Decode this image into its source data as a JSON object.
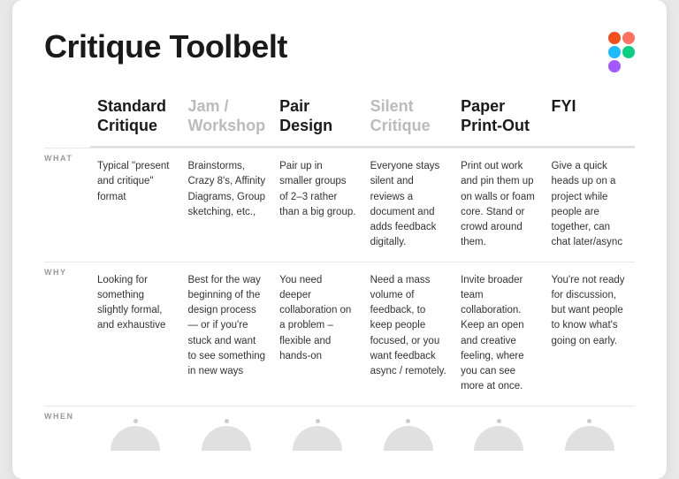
{
  "title": "Critique Toolbelt",
  "figma": {
    "dots": [
      {
        "color": "#F24E1E"
      },
      {
        "color": "#FF7262"
      },
      {
        "color": "#1ABCFE"
      },
      {
        "color": "#0ACF83"
      },
      {
        "color": "#A259FF"
      },
      {
        "color": "#0ACF83"
      }
    ]
  },
  "columns": [
    {
      "header_line1": "Standard",
      "header_line2": "Critique",
      "muted": false,
      "what": "Typical \"present and critique\" format",
      "why": "Looking for something slightly formal, and exhaustive"
    },
    {
      "header_line1": "Jam /",
      "header_line2": "Workshop",
      "muted": true,
      "what": "Brainstorms, Crazy 8's, Affinity Diagrams, Group sketching, etc.,",
      "why": "Best for the way beginning of the design process— or if you're stuck and want to see something in new ways"
    },
    {
      "header_line1": "Pair",
      "header_line2": "Design",
      "muted": false,
      "what": "Pair up in smaller groups of 2–3 rather than a big group.",
      "why": "You need deeper collaboration on a problem – flexible and hands-on"
    },
    {
      "header_line1": "Silent",
      "header_line2": "Critique",
      "muted": true,
      "what": "Everyone stays silent and reviews a document and adds feedback digitally.",
      "why": "Need a mass volume of feedback, to keep people focused, or you want feedback async / remotely."
    },
    {
      "header_line1": "Paper",
      "header_line2": "Print-Out",
      "muted": false,
      "what": "Print out work and pin them up on walls or foam core. Stand or crowd around them.",
      "why": "Invite broader team collaboration. Keep an open and creative feeling, where you can see more at once."
    },
    {
      "header_line1": "FYI",
      "header_line2": "",
      "muted": false,
      "what": "Give a quick heads up on a project while people are together, can chat later/async",
      "why": "You're not ready for discussion, but want people to know what's going on early."
    }
  ],
  "row_labels": {
    "what": "WHAT",
    "why": "WHY",
    "when": "WHEN"
  }
}
